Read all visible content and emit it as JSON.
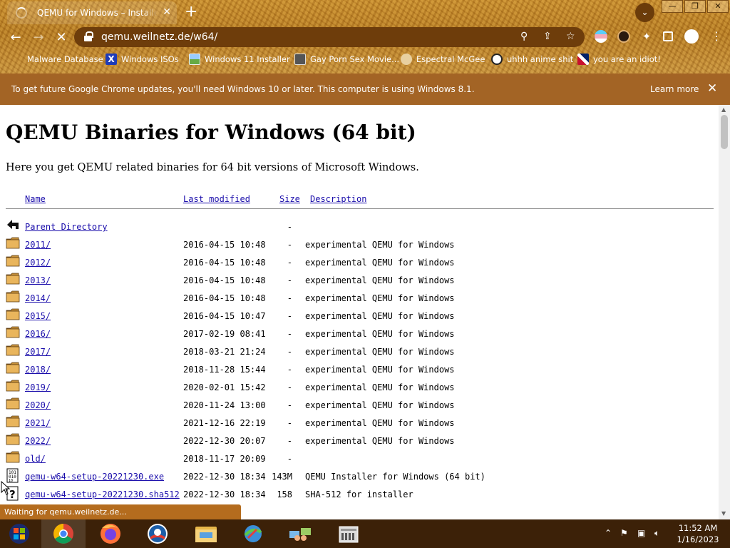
{
  "browser": {
    "tab_title": "QEMU for Windows – Installers (",
    "url": "qemu.weilnetz.de/w64/",
    "bookmarks": [
      {
        "label": "Malware Database",
        "icon": "globe-icon"
      },
      {
        "label": "Windows ISOs",
        "icon": "x-logo-icon"
      },
      {
        "label": "Windows 11 Installer",
        "icon": "image-icon"
      },
      {
        "label": "Gay Porn Sex Movie...",
        "icon": "tower-icon"
      },
      {
        "label": "Espectral McGee",
        "icon": "avatar-icon"
      },
      {
        "label": "uhhh anime shit",
        "icon": "anime-icon"
      },
      {
        "label": "you are an idiot!",
        "icon": "flag-icon"
      }
    ],
    "infobar": {
      "message": "To get future Google Chrome updates, you'll need Windows 10 or later. This computer is using Windows 8.1.",
      "learn_more": "Learn more"
    },
    "status": "Waiting for qemu.weilnetz.de..."
  },
  "page": {
    "title": "QEMU Binaries for Windows (64 bit)",
    "intro": "Here you get QEMU related binaries for 64 bit versions of Microsoft Windows.",
    "columns": {
      "name": "Name",
      "modified": "Last modified",
      "size": "Size",
      "description": "Description"
    },
    "rows": [
      {
        "icon": "back-arrow-icon",
        "name": "Parent Directory",
        "date": "",
        "size": "-",
        "desc": ""
      },
      {
        "icon": "folder-icon",
        "name": "2011/",
        "date": "2016-04-15 10:48",
        "size": "-",
        "desc": "experimental QEMU for Windows"
      },
      {
        "icon": "folder-icon",
        "name": "2012/",
        "date": "2016-04-15 10:48",
        "size": "-",
        "desc": "experimental QEMU for Windows"
      },
      {
        "icon": "folder-icon",
        "name": "2013/",
        "date": "2016-04-15 10:48",
        "size": "-",
        "desc": "experimental QEMU for Windows"
      },
      {
        "icon": "folder-icon",
        "name": "2014/",
        "date": "2016-04-15 10:48",
        "size": "-",
        "desc": "experimental QEMU for Windows"
      },
      {
        "icon": "folder-icon",
        "name": "2015/",
        "date": "2016-04-15 10:47",
        "size": "-",
        "desc": "experimental QEMU for Windows"
      },
      {
        "icon": "folder-icon",
        "name": "2016/",
        "date": "2017-02-19 08:41",
        "size": "-",
        "desc": "experimental QEMU for Windows"
      },
      {
        "icon": "folder-icon",
        "name": "2017/",
        "date": "2018-03-21 21:24",
        "size": "-",
        "desc": "experimental QEMU for Windows"
      },
      {
        "icon": "folder-icon",
        "name": "2018/",
        "date": "2018-11-28 15:44",
        "size": "-",
        "desc": "experimental QEMU for Windows"
      },
      {
        "icon": "folder-icon",
        "name": "2019/",
        "date": "2020-02-01 15:42",
        "size": "-",
        "desc": "experimental QEMU for Windows"
      },
      {
        "icon": "folder-icon",
        "name": "2020/",
        "date": "2020-11-24 13:00",
        "size": "-",
        "desc": "experimental QEMU for Windows"
      },
      {
        "icon": "folder-icon",
        "name": "2021/",
        "date": "2021-12-16 22:19",
        "size": "-",
        "desc": "experimental QEMU for Windows"
      },
      {
        "icon": "folder-icon",
        "name": "2022/",
        "date": "2022-12-30 20:07",
        "size": "-",
        "desc": "experimental QEMU for Windows"
      },
      {
        "icon": "folder-icon",
        "name": "old/",
        "date": "2018-11-17 20:09",
        "size": "-",
        "desc": ""
      },
      {
        "icon": "binary-file-icon",
        "name": "qemu-w64-setup-20221230.exe",
        "date": "2022-12-30 18:34",
        "size": "143M",
        "desc": "QEMU Installer for Windows (64 bit)"
      },
      {
        "icon": "unknown-file-icon",
        "name": "qemu-w64-setup-20221230.sha512",
        "date": "2022-12-30 18:34",
        "size": "158",
        "desc": "SHA-512 for installer"
      }
    ]
  },
  "taskbar": {
    "apps": [
      "start-icon",
      "chrome-icon",
      "firefox-icon",
      "obama-icon",
      "file-explorer-icon",
      "internet-download-icon",
      "network-people-icon",
      "media-creation-icon"
    ],
    "time": "11:52 AM",
    "date": "1/16/2023"
  },
  "colors": {
    "link": "#1a0dab",
    "infobar": "#a36425",
    "taskbar": "#3c2108",
    "omnibox": "#6e3d0b"
  }
}
